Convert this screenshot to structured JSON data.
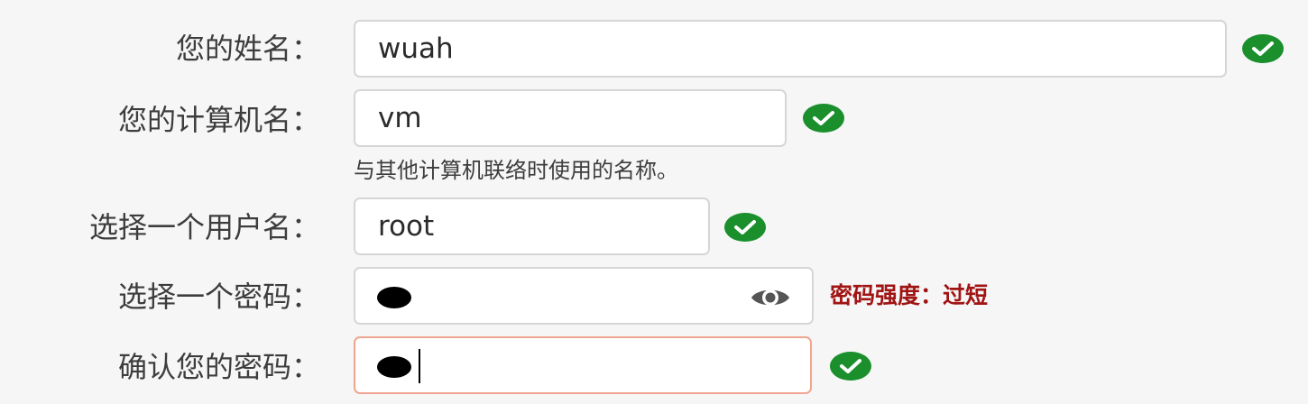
{
  "form": {
    "name": {
      "label": "您的姓名：",
      "value": "wuah"
    },
    "computer": {
      "label": "您的计算机名：",
      "value": "vm",
      "hint": "与其他计算机联络时使用的名称。"
    },
    "username": {
      "label": "选择一个用户名：",
      "value": "root"
    },
    "password": {
      "label": "选择一个密码：",
      "strength": "密码强度：过短"
    },
    "confirm": {
      "label": "确认您的密码："
    }
  },
  "colors": {
    "check_green": "#1a8f2c",
    "strength_red": "#a01414",
    "focus_border": "#f0a590"
  },
  "icons": {
    "valid": "check-circle-icon",
    "reveal": "eye-icon"
  }
}
